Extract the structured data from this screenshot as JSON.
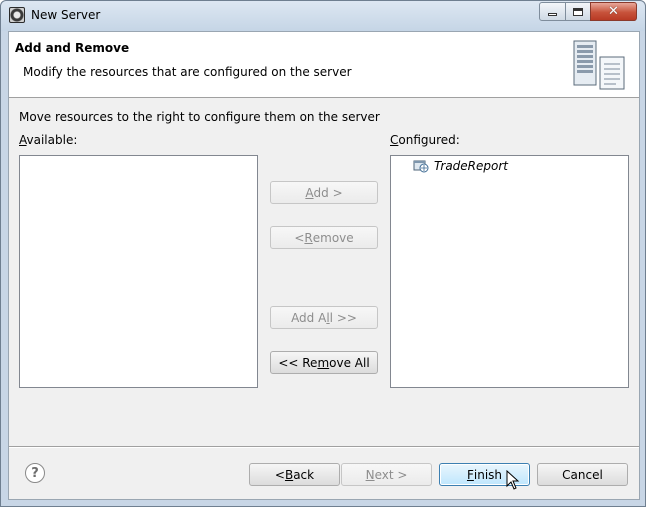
{
  "window": {
    "title": "New Server",
    "controls": {
      "minimize": "minimize",
      "maximize": "maximize",
      "close": "✕"
    }
  },
  "banner": {
    "title": "Add and Remove",
    "description": "Modify the resources that are configured on the server",
    "icon": "server-icon"
  },
  "main": {
    "instruction": "Move resources to the right to configure them on the server",
    "available": {
      "label_prefix": "",
      "label_mnemonic": "A",
      "label_rest": "vailable:",
      "items": []
    },
    "configured": {
      "label_mnemonic": "C",
      "label_rest": "onfigured:",
      "items": [
        {
          "label": "TradeReport",
          "icon": "web-project-icon"
        }
      ]
    }
  },
  "buttons": {
    "add": {
      "pre": "",
      "mn": "A",
      "post": "dd >",
      "enabled": false
    },
    "remove": {
      "pre": "< ",
      "mn": "R",
      "post": "emove",
      "enabled": false
    },
    "add_all": {
      "pre": "Add A",
      "mn": "l",
      "post": "l >>",
      "enabled": false
    },
    "remove_all": {
      "pre": "<< Re",
      "mn": "m",
      "post": "ove All",
      "enabled": true
    }
  },
  "footer": {
    "help": "?",
    "back": {
      "pre": "< ",
      "mn": "B",
      "post": "ack",
      "enabled": true
    },
    "next": {
      "pre": "",
      "mn": "N",
      "post": "ext >",
      "enabled": false
    },
    "finish": {
      "pre": "",
      "mn": "F",
      "post": "inish",
      "enabled": true
    },
    "cancel": {
      "label": "Cancel",
      "enabled": true
    }
  },
  "colors": {
    "titlebar": "#c8d6e6",
    "dialog_bg": "#f0f0f0",
    "default_button": "#bee6fd",
    "close_button": "#c7533b"
  }
}
